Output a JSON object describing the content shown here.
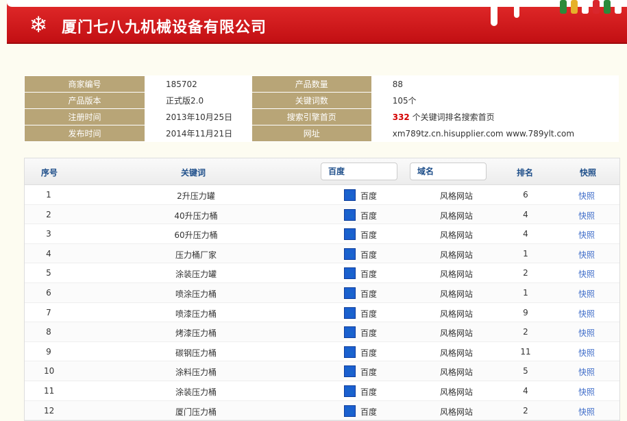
{
  "header": {
    "title": "厦门七八九机械设备有限公司"
  },
  "info": {
    "rows": [
      {
        "k1": "商家编号",
        "v1": "185702",
        "k2": "产品数量",
        "v2": "88"
      },
      {
        "k1": "产品版本",
        "v1": "正式版2.0",
        "k2": "关键词数",
        "v2": "105个"
      },
      {
        "k1": "注册时间",
        "v1": "2013年10月25日",
        "k2": "搜索引擎首页",
        "v2_count": "332",
        "v2_text": "个关键词排名搜索首页"
      },
      {
        "k1": "发布时间",
        "v1": "2014年11月21日",
        "k2": "网址",
        "v2": "xm789tz.cn.hisupplier.com www.789ylt.com"
      }
    ]
  },
  "rank": {
    "headers": {
      "no": "序号",
      "keyword": "关键词",
      "engine": "百度",
      "domain": "域名",
      "rank": "排名",
      "snapshot": "快照"
    },
    "rows": [
      {
        "no": "1",
        "keyword": "2升压力罐",
        "engine": "百度",
        "domain": "风格网站",
        "rank": "6",
        "snapshot": "快照"
      },
      {
        "no": "2",
        "keyword": "40升压力桶",
        "engine": "百度",
        "domain": "风格网站",
        "rank": "4",
        "snapshot": "快照"
      },
      {
        "no": "3",
        "keyword": "60升压力桶",
        "engine": "百度",
        "domain": "风格网站",
        "rank": "4",
        "snapshot": "快照"
      },
      {
        "no": "4",
        "keyword": "压力桶厂家",
        "engine": "百度",
        "domain": "风格网站",
        "rank": "1",
        "snapshot": "快照"
      },
      {
        "no": "5",
        "keyword": "涂装压力罐",
        "engine": "百度",
        "domain": "风格网站",
        "rank": "2",
        "snapshot": "快照"
      },
      {
        "no": "6",
        "keyword": "喷涂压力桶",
        "engine": "百度",
        "domain": "风格网站",
        "rank": "1",
        "snapshot": "快照"
      },
      {
        "no": "7",
        "keyword": "喷漆压力桶",
        "engine": "百度",
        "domain": "风格网站",
        "rank": "9",
        "snapshot": "快照"
      },
      {
        "no": "8",
        "keyword": "烤漆压力桶",
        "engine": "百度",
        "domain": "风格网站",
        "rank": "2",
        "snapshot": "快照"
      },
      {
        "no": "9",
        "keyword": "碳钢压力桶",
        "engine": "百度",
        "domain": "风格网站",
        "rank": "11",
        "snapshot": "快照"
      },
      {
        "no": "10",
        "keyword": "涂料压力桶",
        "engine": "百度",
        "domain": "风格网站",
        "rank": "5",
        "snapshot": "快照"
      },
      {
        "no": "11",
        "keyword": "涂装压力桶",
        "engine": "百度",
        "domain": "风格网站",
        "rank": "4",
        "snapshot": "快照"
      },
      {
        "no": "12",
        "keyword": "厦门压力桶",
        "engine": "百度",
        "domain": "风格网站",
        "rank": "2",
        "snapshot": "快照"
      }
    ]
  }
}
